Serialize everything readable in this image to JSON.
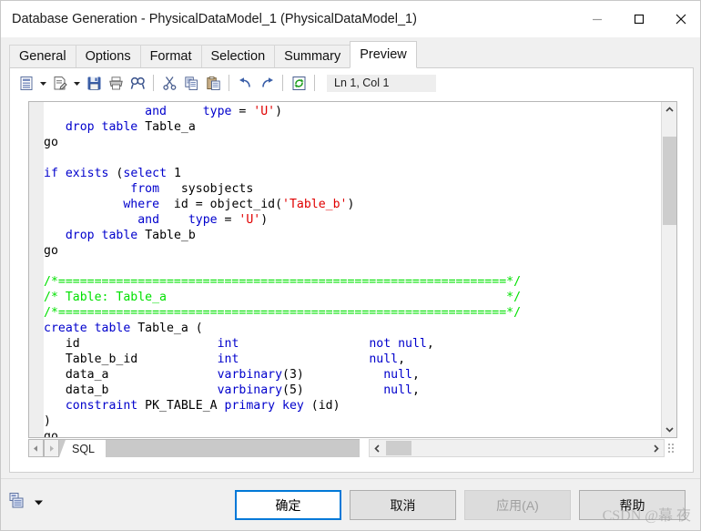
{
  "window": {
    "title": "Database Generation - PhysicalDataModel_1 (PhysicalDataModel_1)",
    "controls": {
      "minimize": "minimize-icon",
      "maximize": "maximize-icon",
      "close": "close-icon"
    }
  },
  "tabs": [
    {
      "label": "General",
      "active": false
    },
    {
      "label": "Options",
      "active": false
    },
    {
      "label": "Format",
      "active": false
    },
    {
      "label": "Selection",
      "active": false
    },
    {
      "label": "Summary",
      "active": false
    },
    {
      "label": "Preview",
      "active": true
    }
  ],
  "toolbar": {
    "items": [
      {
        "name": "preview-selector-icon",
        "type": "button"
      },
      {
        "name": "chevron-down-icon",
        "type": "caret"
      },
      {
        "name": "edit-document-icon",
        "type": "button"
      },
      {
        "name": "chevron-down-icon",
        "type": "caret"
      },
      {
        "name": "save-icon",
        "type": "button"
      },
      {
        "name": "print-icon",
        "type": "button"
      },
      {
        "name": "find-icon",
        "type": "button"
      },
      {
        "name": "separator",
        "type": "sep"
      },
      {
        "name": "cut-icon",
        "type": "button"
      },
      {
        "name": "copy-icon",
        "type": "button"
      },
      {
        "name": "paste-icon",
        "type": "button"
      },
      {
        "name": "separator",
        "type": "sep"
      },
      {
        "name": "undo-icon",
        "type": "button"
      },
      {
        "name": "redo-icon",
        "type": "button"
      },
      {
        "name": "separator",
        "type": "sep"
      },
      {
        "name": "refresh-icon",
        "type": "button"
      },
      {
        "name": "separator",
        "type": "sep"
      }
    ],
    "line_col_status": "Ln 1, Col 1"
  },
  "editor": {
    "code_lines": [
      [
        {
          "t": "              ",
          "c": "plain"
        },
        {
          "t": "and",
          "c": "kw"
        },
        {
          "t": "     ",
          "c": "plain"
        },
        {
          "t": "type",
          "c": "kw"
        },
        {
          "t": " = ",
          "c": "plain"
        },
        {
          "t": "'U'",
          "c": "str"
        },
        {
          "t": ")",
          "c": "plain"
        }
      ],
      [
        {
          "t": "   ",
          "c": "plain"
        },
        {
          "t": "drop",
          "c": "kw"
        },
        {
          "t": " ",
          "c": "plain"
        },
        {
          "t": "table",
          "c": "kw"
        },
        {
          "t": " Table_a",
          "c": "plain"
        }
      ],
      [
        {
          "t": "go",
          "c": "plain"
        }
      ],
      [
        {
          "t": "",
          "c": "plain"
        }
      ],
      [
        {
          "t": "if",
          "c": "kw"
        },
        {
          "t": " ",
          "c": "plain"
        },
        {
          "t": "exists",
          "c": "kw"
        },
        {
          "t": " (",
          "c": "plain"
        },
        {
          "t": "select",
          "c": "kw"
        },
        {
          "t": " 1",
          "c": "plain"
        }
      ],
      [
        {
          "t": "            ",
          "c": "plain"
        },
        {
          "t": "from",
          "c": "kw"
        },
        {
          "t": "   sysobjects",
          "c": "plain"
        }
      ],
      [
        {
          "t": "           ",
          "c": "plain"
        },
        {
          "t": "where",
          "c": "kw"
        },
        {
          "t": "  id = object_id(",
          "c": "plain"
        },
        {
          "t": "'Table_b'",
          "c": "str"
        },
        {
          "t": ")",
          "c": "plain"
        }
      ],
      [
        {
          "t": "             ",
          "c": "plain"
        },
        {
          "t": "and",
          "c": "kw"
        },
        {
          "t": "    ",
          "c": "plain"
        },
        {
          "t": "type",
          "c": "kw"
        },
        {
          "t": " = ",
          "c": "plain"
        },
        {
          "t": "'U'",
          "c": "str"
        },
        {
          "t": ")",
          "c": "plain"
        }
      ],
      [
        {
          "t": "   ",
          "c": "plain"
        },
        {
          "t": "drop",
          "c": "kw"
        },
        {
          "t": " ",
          "c": "plain"
        },
        {
          "t": "table",
          "c": "kw"
        },
        {
          "t": " Table_b",
          "c": "plain"
        }
      ],
      [
        {
          "t": "go",
          "c": "plain"
        }
      ],
      [
        {
          "t": "",
          "c": "plain"
        }
      ],
      [
        {
          "t": "/*==============================================================*/",
          "c": "cmt"
        }
      ],
      [
        {
          "t": "/* Table: Table_a                                               */",
          "c": "cmt"
        }
      ],
      [
        {
          "t": "/*==============================================================*/",
          "c": "cmt"
        }
      ],
      [
        {
          "t": "create",
          "c": "kw"
        },
        {
          "t": " ",
          "c": "plain"
        },
        {
          "t": "table",
          "c": "kw"
        },
        {
          "t": " Table_a (",
          "c": "plain"
        }
      ],
      [
        {
          "t": "   id                   ",
          "c": "plain"
        },
        {
          "t": "int",
          "c": "kw"
        },
        {
          "t": "                  ",
          "c": "plain"
        },
        {
          "t": "not null",
          "c": "kw"
        },
        {
          "t": ",",
          "c": "plain"
        }
      ],
      [
        {
          "t": "   Table_b_id           ",
          "c": "plain"
        },
        {
          "t": "int",
          "c": "kw"
        },
        {
          "t": "                  ",
          "c": "plain"
        },
        {
          "t": "null",
          "c": "kw"
        },
        {
          "t": ",",
          "c": "plain"
        }
      ],
      [
        {
          "t": "   data_a               ",
          "c": "plain"
        },
        {
          "t": "varbinary",
          "c": "kw"
        },
        {
          "t": "(3)           ",
          "c": "plain"
        },
        {
          "t": "null",
          "c": "kw"
        },
        {
          "t": ",",
          "c": "plain"
        }
      ],
      [
        {
          "t": "   data_b               ",
          "c": "plain"
        },
        {
          "t": "varbinary",
          "c": "kw"
        },
        {
          "t": "(5)           ",
          "c": "plain"
        },
        {
          "t": "null",
          "c": "kw"
        },
        {
          "t": ",",
          "c": "plain"
        }
      ],
      [
        {
          "t": "   ",
          "c": "plain"
        },
        {
          "t": "constraint",
          "c": "kw"
        },
        {
          "t": " PK_TABLE_A ",
          "c": "plain"
        },
        {
          "t": "primary key",
          "c": "kw"
        },
        {
          "t": " (id)",
          "c": "plain"
        }
      ],
      [
        {
          "t": ")",
          "c": "plain"
        }
      ],
      [
        {
          "t": "go",
          "c": "plain"
        }
      ]
    ],
    "colors": {
      "keyword": "#0000cc",
      "string": "#e00000",
      "comment": "#00e000",
      "text": "#000000",
      "background": "#ffffff",
      "gutter": "#eeeeee"
    },
    "scrollbar": {
      "up_arrow": "chevron-up-icon",
      "down_arrow": "chevron-down-icon",
      "left_arrow": "chevron-left-icon",
      "right_arrow": "chevron-right-icon"
    }
  },
  "sheet_tabs": {
    "prev_label": "left-triangle-icon",
    "next_label": "right-triangle-icon",
    "tabs": [
      {
        "label": "SQL",
        "active": true
      }
    ]
  },
  "bottom": {
    "menu_icon": "page-options-icon",
    "menu_caret": "chevron-down-icon",
    "buttons": [
      {
        "label": "确定",
        "name": "ok-button",
        "state": "primary"
      },
      {
        "label": "取消",
        "name": "cancel-button",
        "state": "normal"
      },
      {
        "label": "应用(A)",
        "name": "apply-button",
        "state": "disabled"
      },
      {
        "label": "帮助",
        "name": "help-button",
        "state": "normal"
      }
    ]
  },
  "watermark": {
    "text": "CSDN @幕 夜"
  }
}
